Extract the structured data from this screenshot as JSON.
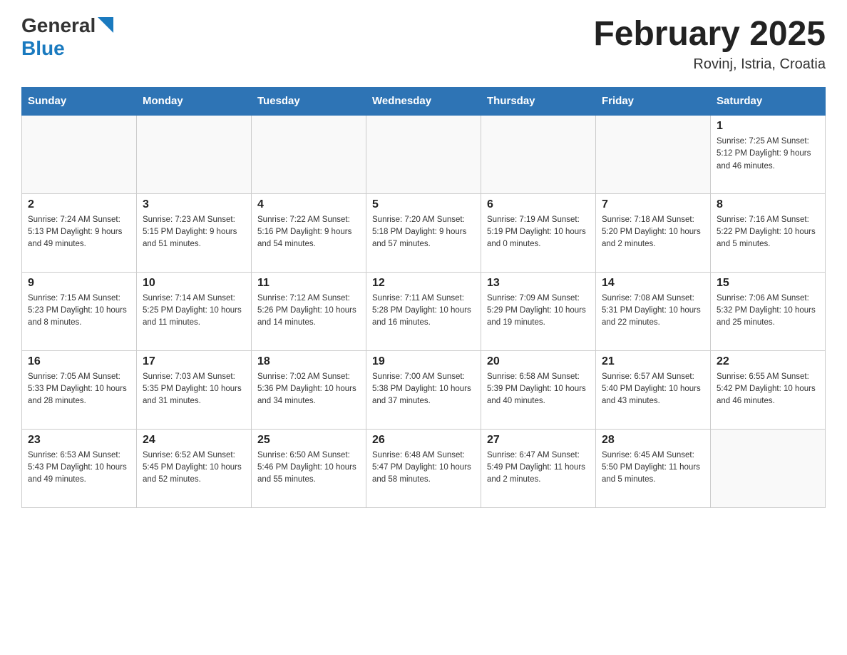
{
  "header": {
    "logo_general": "General",
    "logo_blue": "Blue",
    "month_title": "February 2025",
    "location": "Rovinj, Istria, Croatia"
  },
  "weekdays": [
    "Sunday",
    "Monday",
    "Tuesday",
    "Wednesday",
    "Thursday",
    "Friday",
    "Saturday"
  ],
  "weeks": [
    [
      {
        "day": "",
        "info": ""
      },
      {
        "day": "",
        "info": ""
      },
      {
        "day": "",
        "info": ""
      },
      {
        "day": "",
        "info": ""
      },
      {
        "day": "",
        "info": ""
      },
      {
        "day": "",
        "info": ""
      },
      {
        "day": "1",
        "info": "Sunrise: 7:25 AM\nSunset: 5:12 PM\nDaylight: 9 hours and 46 minutes."
      }
    ],
    [
      {
        "day": "2",
        "info": "Sunrise: 7:24 AM\nSunset: 5:13 PM\nDaylight: 9 hours and 49 minutes."
      },
      {
        "day": "3",
        "info": "Sunrise: 7:23 AM\nSunset: 5:15 PM\nDaylight: 9 hours and 51 minutes."
      },
      {
        "day": "4",
        "info": "Sunrise: 7:22 AM\nSunset: 5:16 PM\nDaylight: 9 hours and 54 minutes."
      },
      {
        "day": "5",
        "info": "Sunrise: 7:20 AM\nSunset: 5:18 PM\nDaylight: 9 hours and 57 minutes."
      },
      {
        "day": "6",
        "info": "Sunrise: 7:19 AM\nSunset: 5:19 PM\nDaylight: 10 hours and 0 minutes."
      },
      {
        "day": "7",
        "info": "Sunrise: 7:18 AM\nSunset: 5:20 PM\nDaylight: 10 hours and 2 minutes."
      },
      {
        "day": "8",
        "info": "Sunrise: 7:16 AM\nSunset: 5:22 PM\nDaylight: 10 hours and 5 minutes."
      }
    ],
    [
      {
        "day": "9",
        "info": "Sunrise: 7:15 AM\nSunset: 5:23 PM\nDaylight: 10 hours and 8 minutes."
      },
      {
        "day": "10",
        "info": "Sunrise: 7:14 AM\nSunset: 5:25 PM\nDaylight: 10 hours and 11 minutes."
      },
      {
        "day": "11",
        "info": "Sunrise: 7:12 AM\nSunset: 5:26 PM\nDaylight: 10 hours and 14 minutes."
      },
      {
        "day": "12",
        "info": "Sunrise: 7:11 AM\nSunset: 5:28 PM\nDaylight: 10 hours and 16 minutes."
      },
      {
        "day": "13",
        "info": "Sunrise: 7:09 AM\nSunset: 5:29 PM\nDaylight: 10 hours and 19 minutes."
      },
      {
        "day": "14",
        "info": "Sunrise: 7:08 AM\nSunset: 5:31 PM\nDaylight: 10 hours and 22 minutes."
      },
      {
        "day": "15",
        "info": "Sunrise: 7:06 AM\nSunset: 5:32 PM\nDaylight: 10 hours and 25 minutes."
      }
    ],
    [
      {
        "day": "16",
        "info": "Sunrise: 7:05 AM\nSunset: 5:33 PM\nDaylight: 10 hours and 28 minutes."
      },
      {
        "day": "17",
        "info": "Sunrise: 7:03 AM\nSunset: 5:35 PM\nDaylight: 10 hours and 31 minutes."
      },
      {
        "day": "18",
        "info": "Sunrise: 7:02 AM\nSunset: 5:36 PM\nDaylight: 10 hours and 34 minutes."
      },
      {
        "day": "19",
        "info": "Sunrise: 7:00 AM\nSunset: 5:38 PM\nDaylight: 10 hours and 37 minutes."
      },
      {
        "day": "20",
        "info": "Sunrise: 6:58 AM\nSunset: 5:39 PM\nDaylight: 10 hours and 40 minutes."
      },
      {
        "day": "21",
        "info": "Sunrise: 6:57 AM\nSunset: 5:40 PM\nDaylight: 10 hours and 43 minutes."
      },
      {
        "day": "22",
        "info": "Sunrise: 6:55 AM\nSunset: 5:42 PM\nDaylight: 10 hours and 46 minutes."
      }
    ],
    [
      {
        "day": "23",
        "info": "Sunrise: 6:53 AM\nSunset: 5:43 PM\nDaylight: 10 hours and 49 minutes."
      },
      {
        "day": "24",
        "info": "Sunrise: 6:52 AM\nSunset: 5:45 PM\nDaylight: 10 hours and 52 minutes."
      },
      {
        "day": "25",
        "info": "Sunrise: 6:50 AM\nSunset: 5:46 PM\nDaylight: 10 hours and 55 minutes."
      },
      {
        "day": "26",
        "info": "Sunrise: 6:48 AM\nSunset: 5:47 PM\nDaylight: 10 hours and 58 minutes."
      },
      {
        "day": "27",
        "info": "Sunrise: 6:47 AM\nSunset: 5:49 PM\nDaylight: 11 hours and 2 minutes."
      },
      {
        "day": "28",
        "info": "Sunrise: 6:45 AM\nSunset: 5:50 PM\nDaylight: 11 hours and 5 minutes."
      },
      {
        "day": "",
        "info": ""
      }
    ]
  ]
}
